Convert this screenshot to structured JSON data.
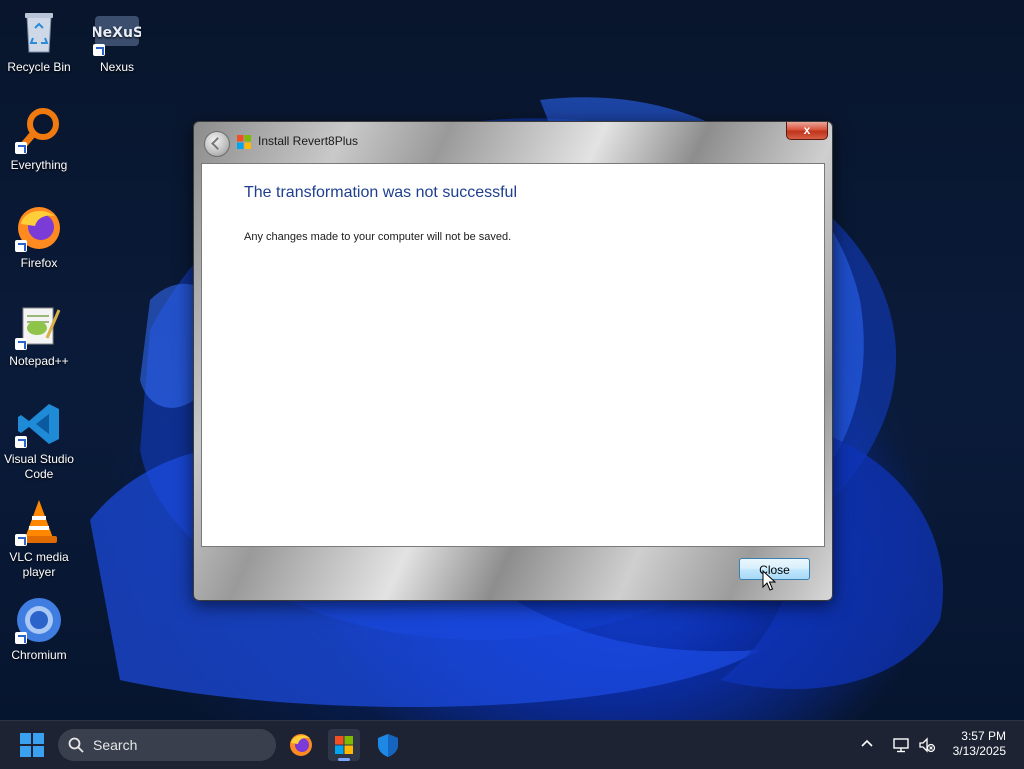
{
  "desktop": {
    "icons": [
      {
        "label": "Recycle Bin",
        "icon": "recycle-bin-icon"
      },
      {
        "label": "Nexus",
        "icon": "nexus-icon"
      },
      {
        "label": "Everything",
        "icon": "everything-search-icon"
      },
      {
        "label": "Firefox",
        "icon": "firefox-icon"
      },
      {
        "label": "Notepad++",
        "icon": "notepadpp-icon"
      },
      {
        "label": "Visual Studio Code",
        "icon": "vscode-icon"
      },
      {
        "label": "VLC media player",
        "icon": "vlc-icon"
      },
      {
        "label": "Chromium",
        "icon": "chromium-icon"
      }
    ],
    "nexus_logo_text": "NeXuS"
  },
  "dialog": {
    "title": "Install Revert8Plus",
    "close_glyph": "x",
    "heading": "The transformation was not successful",
    "message": "Any changes made to your computer will not be saved.",
    "close_button_label": "Close"
  },
  "taskbar": {
    "search_placeholder": "Search",
    "apps": [
      "firefox-icon",
      "installer-icon",
      "shield-icon"
    ],
    "clock_time": "3:57 PM",
    "clock_date": "3/13/2025"
  },
  "colors": {
    "accent_heading": "#1e3f8f",
    "wallpaper_blue": "#1849e0",
    "taskbar_bg": "#1d2333"
  }
}
